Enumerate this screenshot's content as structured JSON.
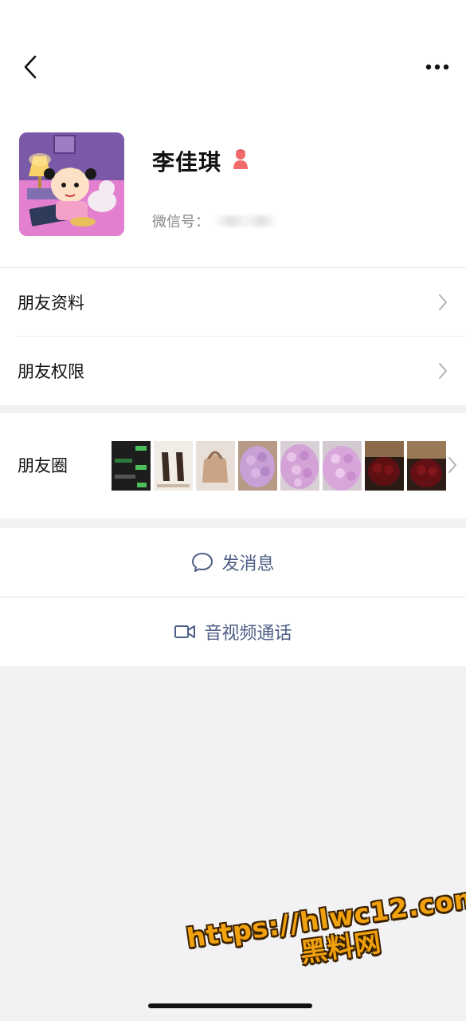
{
  "header": {
    "back_icon": "chevron-left-icon",
    "more_icon": "more-horizontal-icon"
  },
  "profile": {
    "name": "李佳琪",
    "wechat_id_label": "微信号：",
    "gender_icon": "female-person-icon",
    "gender_color": "#f06a6a"
  },
  "menu": {
    "friend_profile": "朋友资料",
    "friend_permissions": "朋友权限",
    "moments": "朋友圈"
  },
  "actions": {
    "send_message": "发消息",
    "video_call": "音视频通话",
    "accent_color": "#4e5f86"
  },
  "watermark": {
    "line1": "https://hlwc12.com",
    "line2": "黑料网"
  }
}
